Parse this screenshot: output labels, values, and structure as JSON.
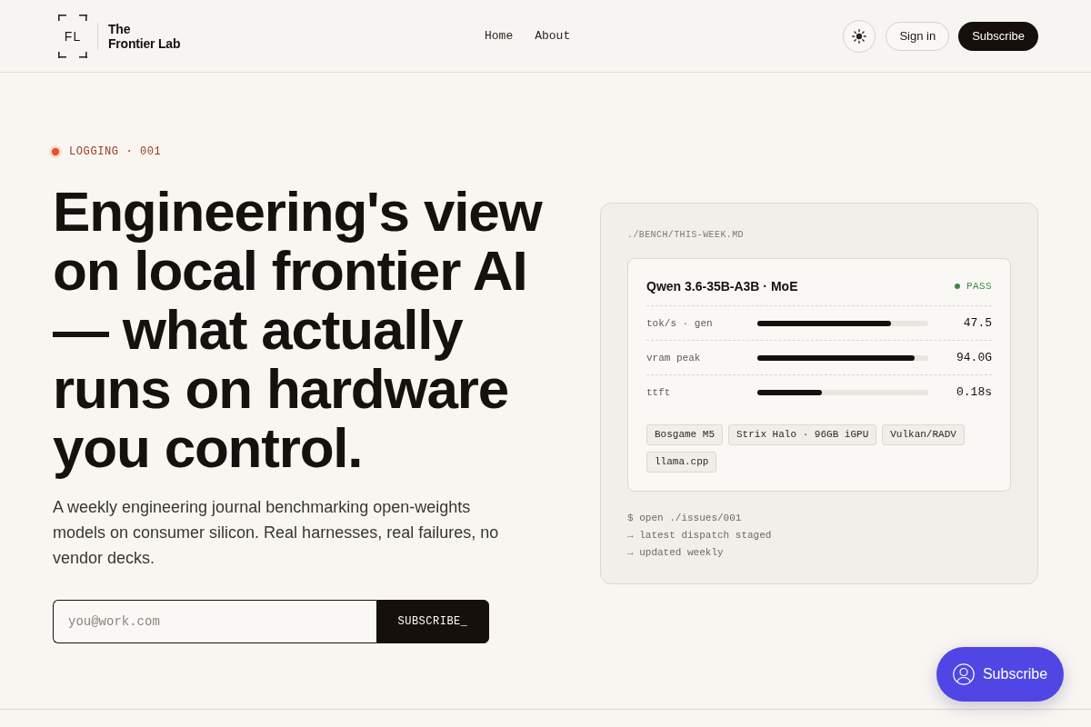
{
  "header": {
    "logo": {
      "mark": "FL",
      "title_lines": [
        "The",
        "Frontier Lab"
      ]
    },
    "nav": [
      {
        "label": "Home"
      },
      {
        "label": "About"
      }
    ],
    "sign_in": "Sign in",
    "subscribe": "Subscribe"
  },
  "hero": {
    "eyebrow": "LOGGING · 001",
    "headline": "Engineering's view on local frontier AI — what actually runs on hardware you control.",
    "lede": "A weekly engineering journal benchmarking open-weights models on consumer silicon. Real harnesses, real failures, no vendor decks.",
    "signup": {
      "placeholder": "you@work.com",
      "button": "SUBSCRIBE_"
    }
  },
  "bench": {
    "path": "./BENCH/THIS-WEEK.MD",
    "card": {
      "title": "Qwen 3.6-35B-A3B · MoE",
      "status": {
        "label": "PASS",
        "ok": true
      },
      "metrics": [
        {
          "name": "tok/s · gen",
          "level": 0.78,
          "reading": "47.5"
        },
        {
          "name": "vram peak",
          "level": 0.92,
          "reading": "94.0G"
        },
        {
          "name": "ttft",
          "level": 0.38,
          "reading": "0.18s"
        }
      ],
      "tags": [
        "Bosgame M5",
        "Strix Halo · 96GB iGPU",
        "Vulkan/RADV",
        "llama.cpp"
      ]
    },
    "terminal": [
      "$ open ./issues/001",
      "→ latest dispatch staged",
      "→ updated weekly"
    ]
  },
  "floating_button": {
    "label": "Subscribe"
  }
}
